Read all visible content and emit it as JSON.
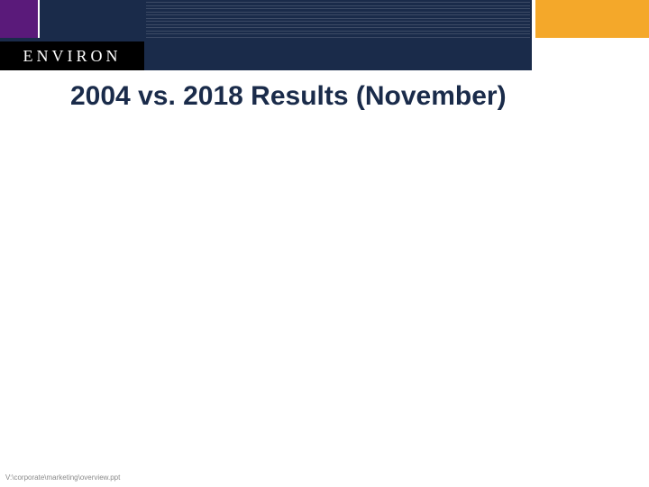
{
  "logo": {
    "text": "ENVIRON"
  },
  "title": "2004 vs. 2018 Results (November)",
  "footer": {
    "path": "V:\\corporate\\marketing\\overview.ppt"
  }
}
